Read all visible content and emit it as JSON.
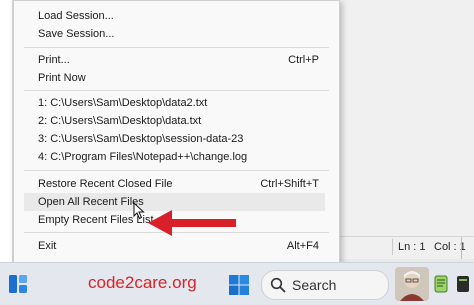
{
  "menu": {
    "items": [
      {
        "label": "Load Session...",
        "shortcut": ""
      },
      {
        "label": "Save Session...",
        "shortcut": ""
      },
      {
        "label": "Print...",
        "shortcut": "Ctrl+P"
      },
      {
        "label": "Print Now",
        "shortcut": ""
      },
      {
        "label": "1: C:\\Users\\Sam\\Desktop\\data2.txt",
        "shortcut": ""
      },
      {
        "label": "2: C:\\Users\\Sam\\Desktop\\data.txt",
        "shortcut": ""
      },
      {
        "label": "3: C:\\Users\\Sam\\Desktop\\session-data-23",
        "shortcut": ""
      },
      {
        "label": "4: C:\\Program Files\\Notepad++\\change.log",
        "shortcut": ""
      },
      {
        "label": "Restore Recent Closed File",
        "shortcut": "Ctrl+Shift+T"
      },
      {
        "label": "Open All Recent Files",
        "shortcut": ""
      },
      {
        "label": "Empty Recent Files List",
        "shortcut": ""
      },
      {
        "label": "Exit",
        "shortcut": "Alt+F4"
      }
    ]
  },
  "status": {
    "ln": "Ln : 1",
    "col": "Col : 1"
  },
  "taskbar": {
    "brand": "code2care.org",
    "search_text": "Search"
  },
  "colors": {
    "arrow": "#d81f2a",
    "brand": "#d8232a",
    "accent": "#0067c0"
  }
}
